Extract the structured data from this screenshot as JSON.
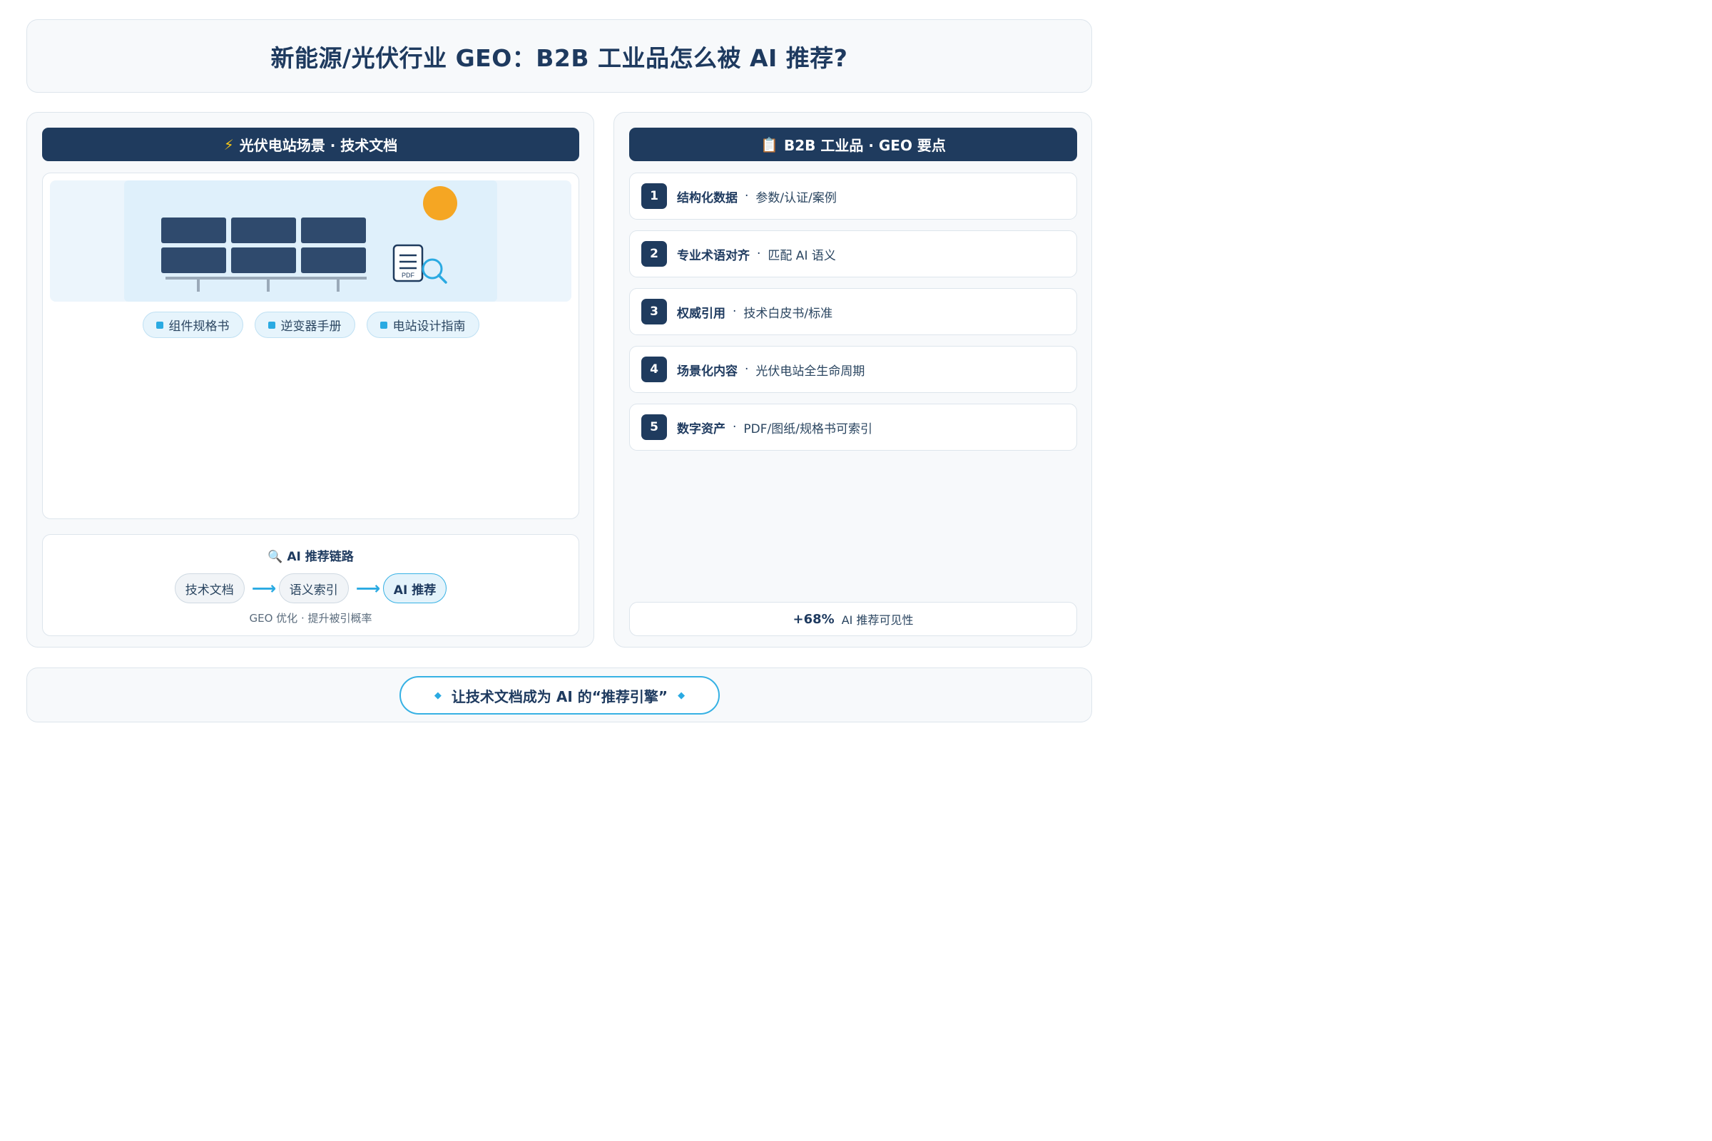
{
  "title": "新能源/光伏行业 GEO：B2B 工业品怎么被 AI 推荐?",
  "left_panel": {
    "header_icon": "⚡",
    "header": "光伏电站场景 · 技术文档",
    "scene": {
      "doc_label": "PDF",
      "tags": [
        "组件规格书",
        "逆变器手册",
        "电站设计指南"
      ]
    },
    "chain": {
      "title": "🔍 AI 推荐链路",
      "nodes": [
        "技术文档",
        "语义索引",
        "AI 推荐"
      ],
      "note": "GEO 优化 · 提升被引概率"
    }
  },
  "right_panel": {
    "header_icon": "📋",
    "header": "B2B 工业品 · GEO 要点",
    "points": [
      {
        "num": "1",
        "title": "结构化数据",
        "desc": "参数/认证/案例"
      },
      {
        "num": "2",
        "title": "专业术语对齐",
        "desc": "匹配 AI 语义"
      },
      {
        "num": "3",
        "title": "权威引用",
        "desc": "技术白皮书/标准"
      },
      {
        "num": "4",
        "title": "场景化内容",
        "desc": "光伏电站全生命周期"
      },
      {
        "num": "5",
        "title": "数字资产",
        "desc": "PDF/图纸/规格书可索引"
      }
    ],
    "stat": {
      "value": "+68%",
      "label": "AI 推荐可见性"
    }
  },
  "footer": {
    "text": "让技术文档成为 AI 的“推荐引擎”",
    "bullet": "◆"
  },
  "colors": {
    "navy": "#1f3b5e",
    "accent": "#2aaae2",
    "sun": "#f5a623",
    "panel_blue": "#2f4a6d"
  },
  "icons": [
    "lightning-icon",
    "clipboard-icon",
    "sun-icon",
    "pdf-document-icon",
    "magnifier-icon",
    "diamond-icon",
    "arrow-right-icon"
  ]
}
